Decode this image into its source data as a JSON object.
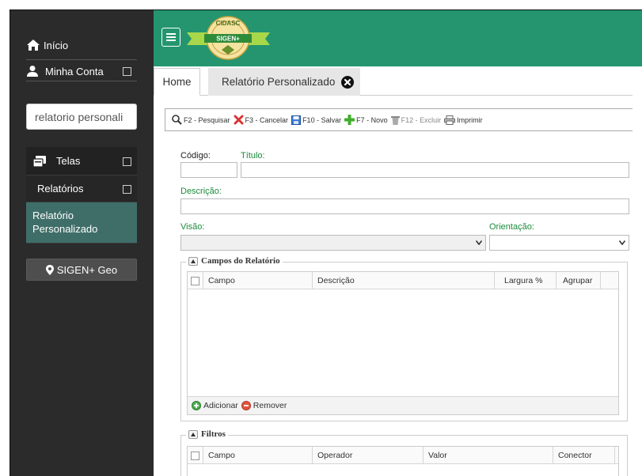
{
  "sidebar": {
    "home_label": "Início",
    "account_label": "Minha Conta",
    "search_value": "relatorio personali",
    "menu": {
      "telas_label": "Telas",
      "relatorios_label": "Relatórios",
      "selected_label": "Relatório Personalizado"
    },
    "geo_button_label": "SIGEN+ Geo"
  },
  "header": {
    "logo_top_text": "CIDASC",
    "logo_banner_text": "SIGEN+"
  },
  "tabs": [
    {
      "label": "Home",
      "active": true
    },
    {
      "label": "Relatório Personalizado",
      "active": false
    }
  ],
  "toolbar": {
    "pesquisar": "F2 - Pesquisar",
    "cancelar": "F3 - Cancelar",
    "salvar": "F10 - Salvar",
    "novo": "F7 - Novo",
    "excluir": "F12 - Excluir",
    "imprimir": "Imprimir"
  },
  "form": {
    "codigo_label": "Código:",
    "titulo_label": "Título:",
    "descricao_label": "Descrição:",
    "visao_label": "Visão:",
    "orientacao_label": "Orientação:",
    "codigo_value": "",
    "titulo_value": "",
    "descricao_value": "",
    "visao_value": "",
    "orientacao_value": ""
  },
  "campos_group": {
    "legend": "Campos do Relatório",
    "columns": [
      "Campo",
      "Descrição",
      "Largura %",
      "Agrupar"
    ],
    "rows": [],
    "add_label": "Adicionar",
    "remove_label": "Remover"
  },
  "filtros_group": {
    "legend": "Filtros",
    "columns": [
      "Campo",
      "Operador",
      "Valor",
      "Conector"
    ],
    "rows": []
  },
  "colors": {
    "sidebar_bg": "#2b2b2b",
    "header_green": "#24956f",
    "selected_item": "#3f6e69",
    "label_green": "#1b8a3b"
  }
}
